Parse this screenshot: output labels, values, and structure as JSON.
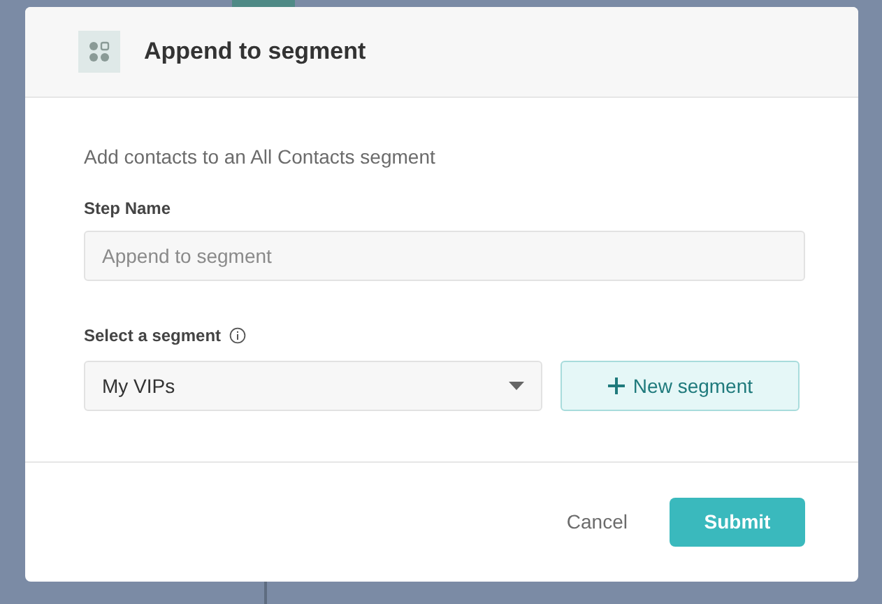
{
  "dialog": {
    "title": "Append to segment",
    "description": "Add contacts to an All Contacts segment"
  },
  "step_name": {
    "label": "Step Name",
    "placeholder": "Append to segment"
  },
  "segment": {
    "label": "Select a segment",
    "value": "My VIPs",
    "new_button": "New segment"
  },
  "footer": {
    "buttons": [
      {
        "label": "Cancel",
        "kind": "secondary"
      },
      {
        "label": "Submit",
        "kind": "primary"
      }
    ]
  }
}
